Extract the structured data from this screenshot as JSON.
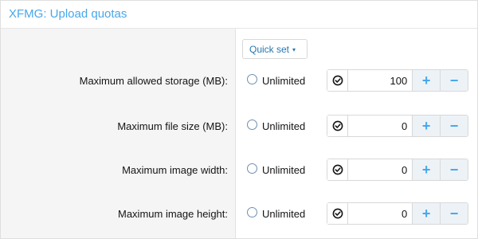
{
  "panel": {
    "title": "XFMG: Upload quotas"
  },
  "quick_set": {
    "label": "Quick set",
    "caret": "▾"
  },
  "unlimited_label": "Unlimited",
  "fields": [
    {
      "label": "Maximum allowed storage (MB):",
      "value": "100",
      "plus": "+",
      "minus": "−"
    },
    {
      "label": "Maximum file size (MB):",
      "value": "0",
      "plus": "+",
      "minus": "−"
    },
    {
      "label": "Maximum image width:",
      "value": "0",
      "plus": "+",
      "minus": "−"
    },
    {
      "label": "Maximum image height:",
      "value": "0",
      "plus": "+",
      "minus": "−"
    }
  ],
  "colors": {
    "accent": "#47a7eb",
    "link": "#2577b1",
    "label_bg": "#f5f5f5",
    "step_bg": "#edf2f7"
  }
}
